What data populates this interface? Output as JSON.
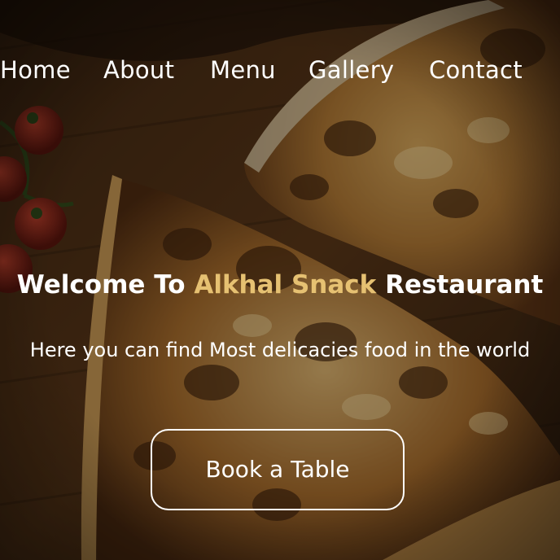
{
  "nav": {
    "items": [
      {
        "label": "Home"
      },
      {
        "label": "About"
      },
      {
        "label": "Menu"
      },
      {
        "label": "Gallery"
      },
      {
        "label": "Contact"
      }
    ]
  },
  "hero": {
    "headline_prefix": "Welcome To ",
    "headline_accent": "Alkhal Snack",
    "headline_suffix": " Restaurant",
    "subtitle": "Here you can find Most delicacies food in the world",
    "cta_label": "Book a Table",
    "background_image": "pizza-on-wooden-board-photo"
  },
  "colors": {
    "accent": "#e6c172",
    "text": "#ffffff",
    "overlay": "#0a0603"
  }
}
